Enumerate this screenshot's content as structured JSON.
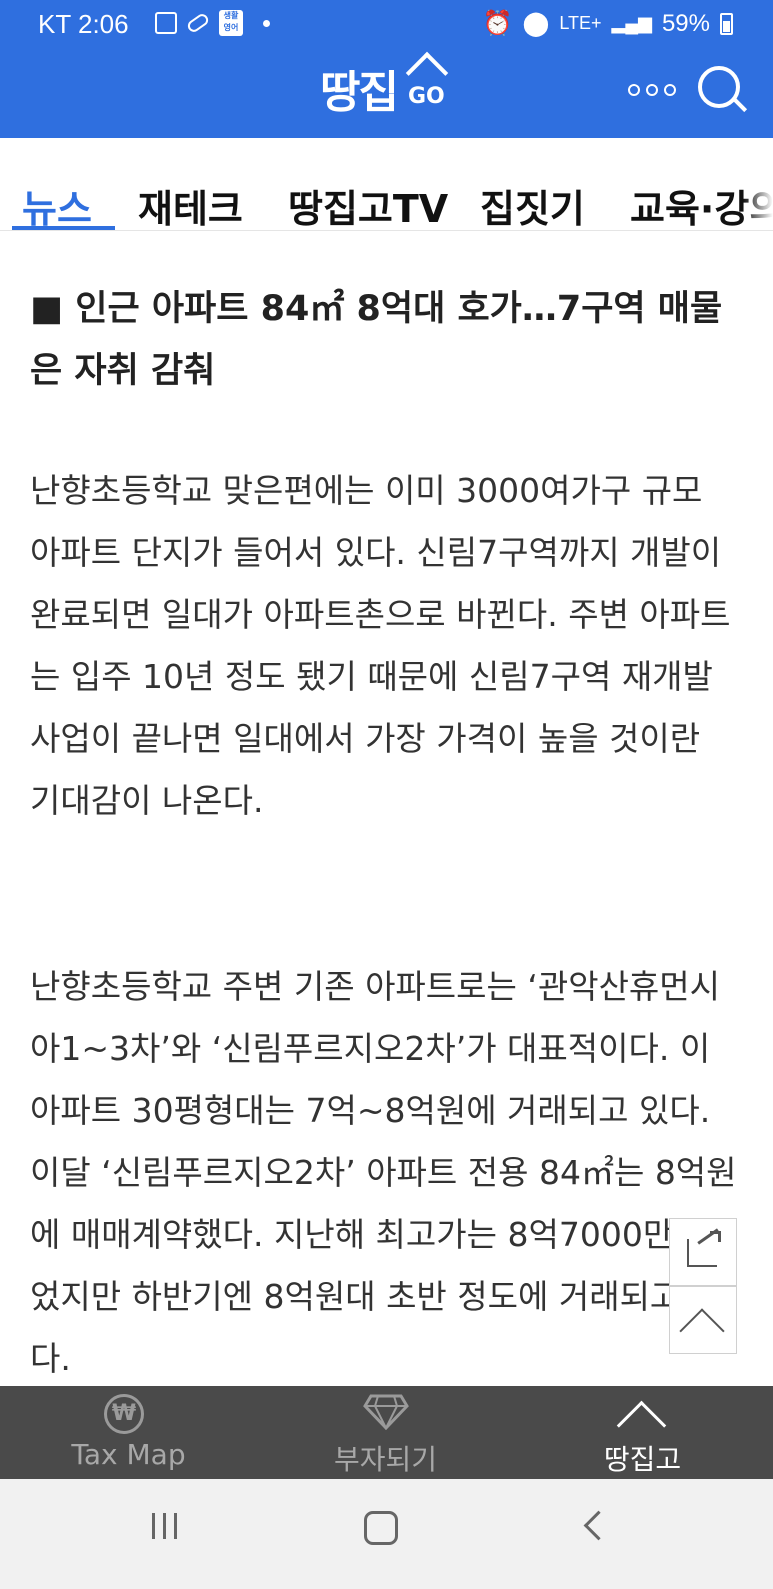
{
  "status_bar": {
    "carrier_time": "KT 2:06",
    "network": "LTE+",
    "battery": "59%"
  },
  "header": {
    "logo_text": "땅집",
    "logo_suffix": "GO"
  },
  "tabs": [
    {
      "label": "뉴스",
      "active": true
    },
    {
      "label": "재테크"
    },
    {
      "label": "땅집고TV"
    },
    {
      "label": "집짓기"
    },
    {
      "label": "교육·강의"
    }
  ],
  "article": {
    "subheading": "■ 인근 아파트 84㎡ 8억대 호가…7구역 매물은 자취 감춰",
    "paragraph1": "난향초등학교 맞은편에는 이미 3000여가구 규모 아파트 단지가 들어서 있다. 신림7구역까지 개발이 완료되면 일대가 아파트촌으로 바뀐다. 주변 아파트는 입주 10년 정도 됐기 때문에 신림7구역 재개발 사업이 끝나면 일대에서 가장 가격이 높을 것이란 기대감이 나온다.",
    "paragraph2": "난향초등학교 주변 기존 아파트로는 ‘관악산휴먼시아1~3차’와 ‘신림푸르지오2차’가 대표적이다. 이 아파트 30평형대는 7억~8억원에 거래되고 있다. 이달 ‘신림푸르지오2차’ 아파트 전용 84㎡는 8억원에 매매계약했다. 지난해 최고가는 8억7000만원이었지만 하반기엔 8억원대 초반 정도에 거래되고 있다."
  },
  "bottom_tabs": [
    {
      "label": "Tax Map",
      "icon": "won-coin-icon"
    },
    {
      "label": "부자되기",
      "icon": "diamond-icon"
    },
    {
      "label": "땅집고",
      "icon": "chevron-up-icon",
      "active": true
    }
  ],
  "colors": {
    "brand_blue": "#2f6fdf",
    "bottom_bar": "#4a4a4a"
  }
}
